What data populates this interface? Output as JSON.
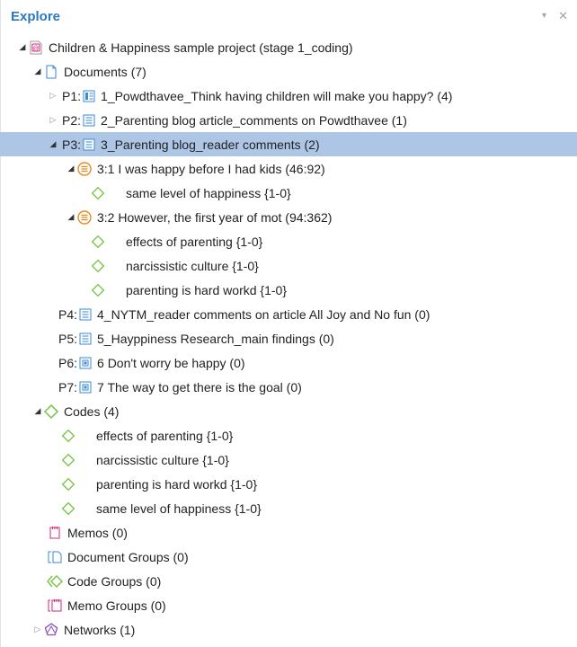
{
  "panel": {
    "title": "Explore",
    "pin_glyph": "▾",
    "close_glyph": "✕"
  },
  "colors": {
    "title_blue": "#2b78c4",
    "selection": "#adc6e6",
    "code_green": "#76c442",
    "quote_orange": "#e88a1f",
    "doc_blue": "#3a8ad6",
    "memo_pink": "#d0257a",
    "network_purple": "#8a4fb5"
  },
  "tree": {
    "project": {
      "label": "Children & Happiness sample project (stage 1_coding)",
      "icon": "project-icon"
    },
    "documents": {
      "label": "Documents (7)",
      "items": [
        {
          "prefix": "P1:",
          "label": "1_Powdthavee_Think having children will make you happy? (4)",
          "icon": "pdf-document-icon"
        },
        {
          "prefix": "P2:",
          "label": "2_Parenting blog article_comments on Powdthavee (1)",
          "icon": "text-document-icon"
        },
        {
          "prefix": "P3:",
          "label": "3_Parenting blog_reader comments (2)",
          "icon": "text-document-icon"
        },
        {
          "prefix": "P4:",
          "label": "4_NYTM_reader comments on article All Joy and No fun (0)",
          "icon": "text-document-icon"
        },
        {
          "prefix": "P5:",
          "label": "5_Hayppiness Research_main findings (0)",
          "icon": "text-document-icon"
        },
        {
          "prefix": "P6:",
          "label": "6 Don't worry be happy (0)",
          "icon": "image-document-icon"
        },
        {
          "prefix": "P7:",
          "label": "7 The way to get there is the goal (0)",
          "icon": "image-document-icon"
        }
      ]
    },
    "quotations": [
      {
        "label": "3:1 I was happy before I had kids  (46:92)",
        "codes": [
          "same level of happiness {1-0}"
        ]
      },
      {
        "label": "3:2 However, the first year of mot (94:362)",
        "codes": [
          "effects of parenting {1-0}",
          "narcissistic culture {1-0}",
          "parenting is hard workd {1-0}"
        ]
      }
    ],
    "codes": {
      "label": "Codes (4)",
      "items": [
        "effects of parenting {1-0}",
        "narcissistic culture {1-0}",
        "parenting is hard workd {1-0}",
        "same level of happiness {1-0}"
      ]
    },
    "memos": {
      "label": "Memos (0)"
    },
    "document_groups": {
      "label": "Document Groups (0)"
    },
    "code_groups": {
      "label": "Code Groups (0)"
    },
    "memo_groups": {
      "label": "Memo Groups (0)"
    },
    "networks": {
      "label": "Networks (1)"
    }
  }
}
